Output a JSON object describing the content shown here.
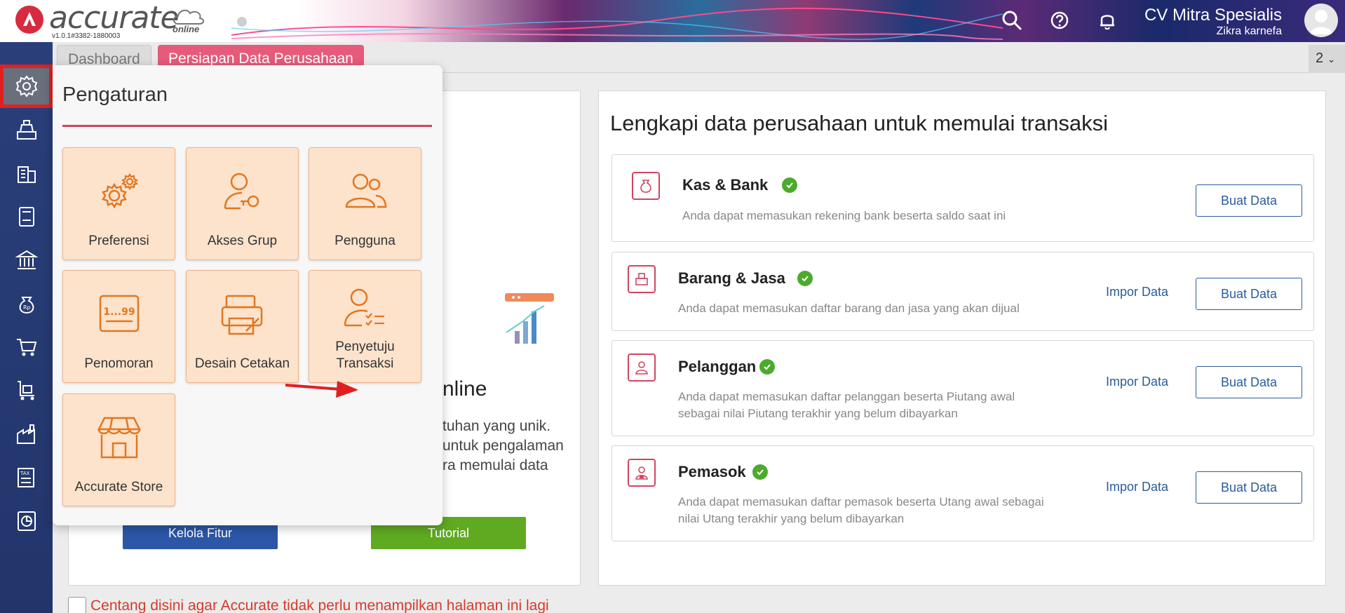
{
  "header": {
    "logo_text": "accurate",
    "logo_sub": "online",
    "version": "v1.0.1#3382-1880003",
    "company_name": "CV Mitra Spesialis",
    "user_name": "Zikra karnefa",
    "icons": [
      "search-icon",
      "help-icon",
      "bell-icon"
    ]
  },
  "tabs": {
    "dashboard": "Dashboard",
    "active": "Persiapan Data Perusahaan",
    "count": "2"
  },
  "leftnav": {
    "items": [
      "gear-icon",
      "cash-register-icon",
      "building-icon",
      "ledger-icon",
      "bank-icon",
      "money-bag-icon",
      "cart-icon",
      "trolley-icon",
      "factory-icon",
      "tax-icon",
      "report-icon"
    ]
  },
  "panel": {
    "title": "Pengaturan",
    "tiles": [
      {
        "label": "Preferensi",
        "icon": "gears-icon"
      },
      {
        "label": "Akses Grup",
        "icon": "user-key-icon"
      },
      {
        "label": "Pengguna",
        "icon": "users-icon"
      },
      {
        "label": "Penomoran",
        "icon": "numbering-icon",
        "icon_text": "1...99"
      },
      {
        "label": "Desain Cetakan",
        "icon": "printer-icon"
      },
      {
        "label": "Penyetuju Transaksi",
        "label_line1": "Penyetuju",
        "label_line2": "Transaksi",
        "icon": "user-checklist-icon"
      },
      {
        "label": "Accurate Store",
        "icon": "store-icon"
      }
    ]
  },
  "left_card": {
    "heading_fragment": "nline",
    "text_lines": [
      "tuhan yang unik.",
      "untuk pengalaman",
      "ra memulai data"
    ],
    "kelola_button": "Kelola Fitur",
    "tutorial_button": "Tutorial"
  },
  "right_card": {
    "title": "Lengkapi data perusahaan untuk memulai transaksi",
    "items": [
      {
        "title": "Kas & Bank",
        "desc_line1": "Anda dapat memasukan rekening bank beserta saldo saat ini",
        "desc_line2": "",
        "import": "",
        "create": "Buat Data",
        "icon": "money-bag-icon"
      },
      {
        "title": "Barang & Jasa",
        "desc_line1": "Anda dapat memasukan daftar barang dan jasa yang akan dijual",
        "desc_line2": "",
        "import": "Impor Data",
        "create": "Buat Data",
        "icon": "boxes-icon"
      },
      {
        "title": "Pelanggan",
        "desc_line1": "Anda dapat memasukan daftar pelanggan beserta Piutang awal",
        "desc_line2": "sebagai nilai Piutang terakhir yang belum dibayarkan",
        "import": "Impor Data",
        "create": "Buat Data",
        "icon": "customer-icon"
      },
      {
        "title": "Pemasok",
        "desc_line1": "Anda dapat memasukan daftar pemasok beserta Utang awal sebagai",
        "desc_line2": "nilai Utang terakhir yang belum dibayarkan",
        "import": "Impor Data",
        "create": "Buat Data",
        "icon": "supplier-icon"
      }
    ]
  },
  "footer": {
    "checkbox_label": "Centang disini agar Accurate tidak perlu menampilkan halaman ini lagi"
  },
  "colors": {
    "accent_pink": "#e65a7a",
    "nav_blue": "#2a3f7a",
    "tile_bg": "#fde3cc",
    "icon_orange": "#e2761f",
    "check_green": "#4caa2c",
    "link_blue": "#2a5c9a"
  }
}
